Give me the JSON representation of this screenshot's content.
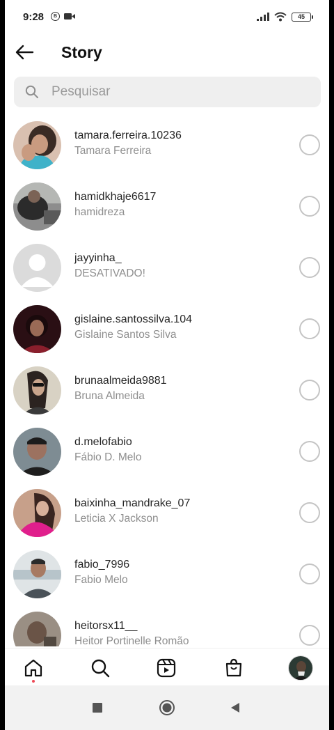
{
  "status_bar": {
    "time": "9:28",
    "battery": "45"
  },
  "header": {
    "title": "Story",
    "back_icon": "arrow-left-icon"
  },
  "search": {
    "placeholder": "Pesquisar",
    "value": ""
  },
  "contacts": [
    {
      "username": "tamara.ferreira.10236",
      "full_name": "Tamara Ferreira",
      "selected": false
    },
    {
      "username": "hamidkhaje6617",
      "full_name": "hamidreza",
      "selected": false
    },
    {
      "username": "jayyinha_",
      "full_name": "DESATIVADO!",
      "selected": false
    },
    {
      "username": "gislaine.santossilva.104",
      "full_name": "Gislaine Santos Silva",
      "selected": false
    },
    {
      "username": "brunaalmeida9881",
      "full_name": "Bruna Almeida",
      "selected": false
    },
    {
      "username": "d.melofabio",
      "full_name": "Fábio D. Melo",
      "selected": false
    },
    {
      "username": "baixinha_mandrake_07",
      "full_name": "Leticia X Jackson",
      "selected": false
    },
    {
      "username": "fabio_7996",
      "full_name": "Fabio Melo",
      "selected": false
    },
    {
      "username": "heitorsx11__",
      "full_name": "Heitor Portinelle Romão",
      "selected": false
    }
  ],
  "bottom_nav": [
    {
      "name": "home-icon",
      "active": true
    },
    {
      "name": "search-icon"
    },
    {
      "name": "reels-icon"
    },
    {
      "name": "shop-icon"
    },
    {
      "name": "profile-avatar"
    }
  ],
  "colors": {
    "active_dot": "#ed4956",
    "radio_border": "#c4c4c4",
    "secondary_text": "#8e8e8e"
  }
}
